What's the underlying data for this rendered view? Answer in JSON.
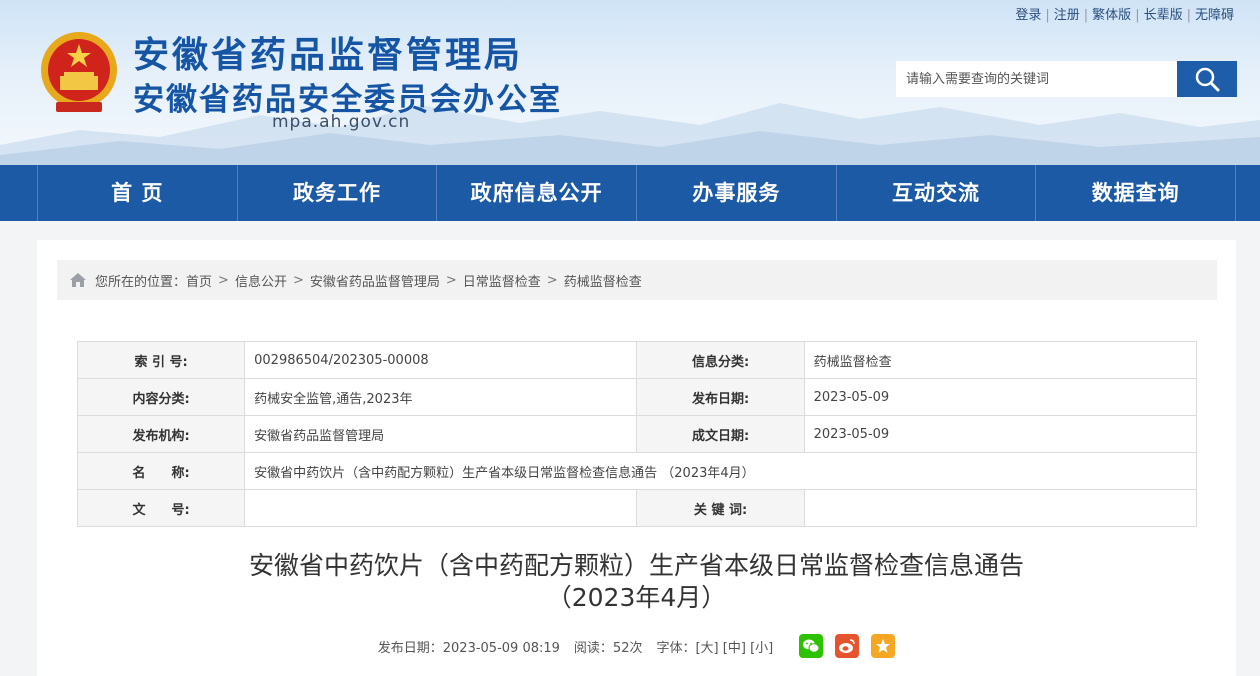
{
  "header": {
    "title_main": "安徽省药品监督管理局",
    "title_sub": "安徽省药品安全委员会办公室",
    "domain": "mpa.ah.gov.cn",
    "top_links": [
      "登录",
      "注册",
      "繁体版",
      "长辈版",
      "无障碍"
    ],
    "search_placeholder": "请输入需要查询的关键词"
  },
  "nav": {
    "items": [
      "首 页",
      "政务工作",
      "政府信息公开",
      "办事服务",
      "互动交流",
      "数据查询"
    ]
  },
  "breadcrumb": {
    "prefix": "您所在的位置：",
    "items": [
      "首页",
      "信息公开",
      "安徽省药品监督管理局",
      "日常监督检查",
      "药械监督检查"
    ],
    "separator": ">"
  },
  "meta_table": {
    "index_label": "索 引 号:",
    "index_value": "002986504/202305-00008",
    "category_label": "信息分类:",
    "category_value": "药械监督检查",
    "content_label": "内容分类:",
    "content_value": "药械安全监管,通告,2023年",
    "publish_date_label": "发布日期:",
    "publish_date_value": "2023-05-09",
    "org_label": "发布机构:",
    "org_value": "安徽省药品监督管理局",
    "written_date_label": "成文日期:",
    "written_date_value": "2023-05-09",
    "name_label": "名　　称:",
    "name_value": "安徽省中药饮片（含中药配方颗粒）生产省本级日常监督检查信息通告 （2023年4月）",
    "doc_no_label": "文　　号:",
    "doc_no_value": "",
    "keywords_label": "关 键 词:",
    "keywords_value": ""
  },
  "article": {
    "title_line1": "安徽省中药饮片（含中药配方颗粒）生产省本级日常监督检查信息通告",
    "title_line2": "（2023年4月）",
    "publish_label": "发布日期：2023-05-09 08:19",
    "reads_label": "阅读：52次",
    "font_label": "字体：",
    "font_large": "[大]",
    "font_medium": "[中]",
    "font_small": "[小]"
  },
  "colors": {
    "brand_blue": "#1c5aa6",
    "title_blue": "#1555a4",
    "wechat": "#2dc100",
    "weibo": "#e6542e",
    "qzone": "#f5a623"
  }
}
